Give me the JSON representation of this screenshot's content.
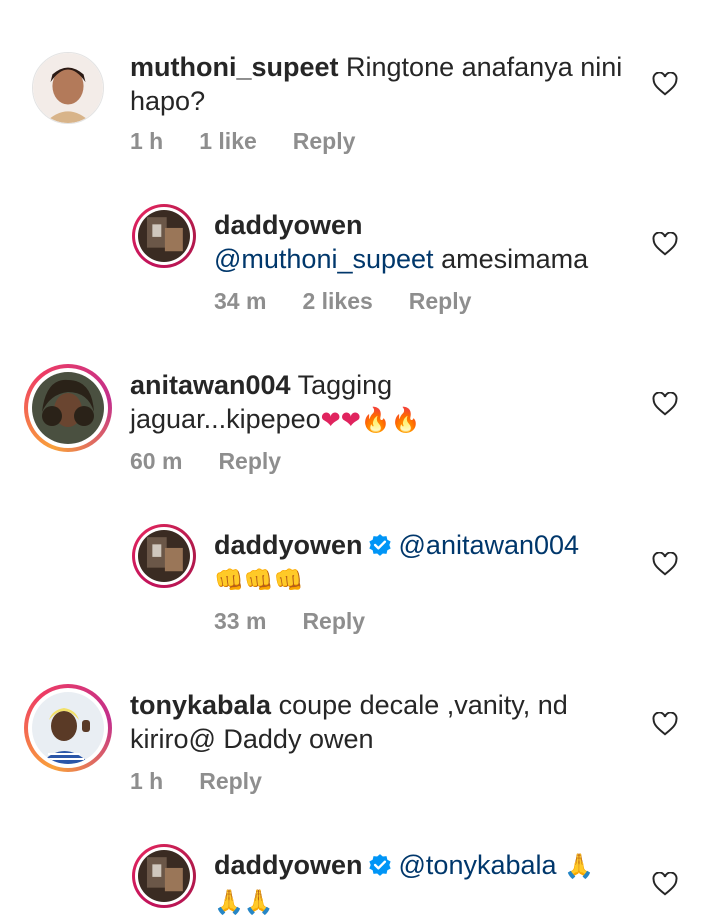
{
  "comments": [
    {
      "username": "muthoni_supeet",
      "text": "Ringtone anafanya nini",
      "text2": "hapo?",
      "time": "1 h",
      "likes": "1 like",
      "reply": "Reply"
    },
    {
      "username": "daddyowen",
      "mention": "@muthoni_supeet",
      "text": "amesimama",
      "time": "34 m",
      "likes": "2 likes",
      "reply": "Reply"
    },
    {
      "username": "anitawan004",
      "text": "Tagging",
      "text2": "jaguar...kipepeo",
      "emojis": "❤❤🔥🔥",
      "time": "60 m",
      "reply": "Reply"
    },
    {
      "username": "daddyowen",
      "mention": "@anitawan004",
      "emojis": "👊👊👊",
      "time": "33 m",
      "reply": "Reply"
    },
    {
      "username": "tonykabala",
      "text": "coupe decale ,vanity, nd",
      "text2": "kiriro@ Daddy owen",
      "time": "1 h",
      "reply": "Reply"
    },
    {
      "username": "daddyowen",
      "mention": "@tonykabala",
      "emojis": "🙏",
      "emojis2": "🙏🙏"
    }
  ],
  "colors": {
    "text": "#262626",
    "meta": "#8e8e8e",
    "mention": "#00376b",
    "verified": "#0095f6",
    "heart_emoji": "#e0245e"
  }
}
